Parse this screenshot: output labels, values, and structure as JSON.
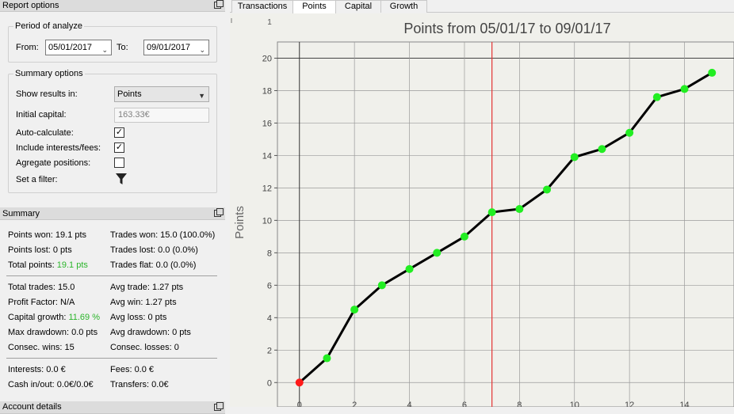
{
  "report_options": {
    "title": "Report options",
    "period": {
      "title": "Period of analyze",
      "from_label": "From:",
      "from_value": "05/01/2017",
      "to_label": "To:",
      "to_value": "09/01/2017"
    },
    "summary_options": {
      "title": "Summary options",
      "show_results_label": "Show results in:",
      "show_results_value": "Points",
      "initial_capital_label": "Initial capital:",
      "initial_capital_value": "163.33€",
      "auto_calculate_label": "Auto-calculate:",
      "auto_calculate_checked": true,
      "include_interests_label": "Include interests/fees:",
      "include_interests_checked": true,
      "aggregate_label": "Agregate positions:",
      "aggregate_checked": false,
      "filter_label": "Set a filter:",
      "filter_icon": "filter-icon"
    }
  },
  "summary": {
    "title": "Summary",
    "points_won": "Points won: 19.1 pts",
    "trades_won": "Trades won: 15.0 (100.0%)",
    "points_lost": "Points lost: 0 pts",
    "trades_lost": "Trades lost: 0.0 (0.0%)",
    "total_points_label": "Total points:",
    "total_points_value": "19.1 pts",
    "trades_flat": "Trades flat: 0.0 (0.0%)",
    "total_trades": "Total trades: 15.0",
    "avg_trade": "Avg trade: 1.27 pts",
    "profit_factor": "Profit Factor: N/A",
    "avg_win": "Avg win: 1.27 pts",
    "capital_growth_label": "Capital growth:",
    "capital_growth_value": "11.69 %",
    "avg_loss": "Avg loss: 0 pts",
    "max_drawdown": "Max drawdown: 0.0 pts",
    "avg_drawdown": "Avg drawdown: 0 pts",
    "consec_wins": "Consec. wins: 15",
    "consec_losses": "Consec. losses: 0",
    "interests": "Interests: 0.0 €",
    "fees": "Fees: 0.0 €",
    "cash_in_out": "Cash in/out: 0.0€/0.0€",
    "transfers": "Transfers: 0.0€",
    "next_panel": "Account details"
  },
  "tabs": [
    {
      "label": "Transactions",
      "active": false
    },
    {
      "label": "Points",
      "active": true
    },
    {
      "label": "Capital",
      "active": false
    },
    {
      "label": "Growth",
      "active": false
    }
  ],
  "chart_data": {
    "type": "line",
    "title": "Points from 05/01/17 to 09/01/17",
    "xlabel": "",
    "ylabel": "Points",
    "x": [
      0,
      1,
      2,
      3,
      4,
      5,
      6,
      7,
      8,
      9,
      10,
      11,
      12,
      13,
      14,
      15
    ],
    "values": [
      0,
      1.5,
      4.5,
      6.0,
      7.0,
      8.0,
      9.0,
      10.5,
      10.7,
      11.9,
      13.9,
      14.4,
      15.4,
      17.6,
      18.1,
      19.1
    ],
    "xlim": [
      -0.8,
      15.8
    ],
    "ylim": [
      -1.5,
      21
    ],
    "xticks": [
      0,
      2,
      4,
      6,
      8,
      10,
      12,
      14
    ],
    "yticks": [
      0,
      2,
      4,
      6,
      8,
      10,
      12,
      14,
      16,
      18,
      20
    ],
    "vertical_marker_x": 7,
    "grid": true,
    "colors": {
      "line": "#000000",
      "point": "#22ee22",
      "first_point": "#ff1a1a",
      "marker": "#e33333",
      "grid": "#9a9a9a",
      "background": "#f0f0eb"
    },
    "corner_tick": "1"
  }
}
